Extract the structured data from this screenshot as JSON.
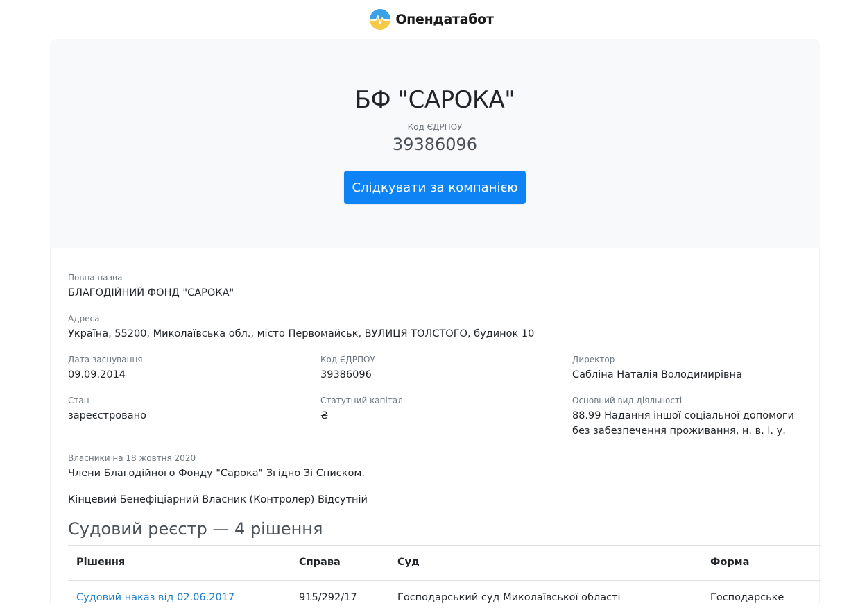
{
  "header": {
    "brand_name": "Опендатабот",
    "logo_icon": "opendatabot-logo-icon",
    "colors": {
      "logo_blue": "#3aa0e8",
      "logo_yellow": "#f7c948"
    }
  },
  "company": {
    "short_name": "БФ \"САРОКА\"",
    "code_label": "Код ЄДРПОУ",
    "code": "39386096",
    "follow_label": "Слідкувати за компанією",
    "accent_color": "#0d83f5"
  },
  "details": {
    "full_name_label": "Повна назва",
    "full_name": "БЛАГОДІЙНИЙ ФОНД \"САРОКА\"",
    "address_label": "Адреса",
    "address": "Україна, 55200, Миколаївська обл., місто Первомайськ, ВУЛИЦЯ ТОЛСТОГО, будинок 10",
    "founded_label": "Дата заснування",
    "founded": "09.09.2014",
    "edrpou_label": "Код ЄДРПОУ",
    "edrpou": "39386096",
    "director_label": "Директор",
    "director": "Сабліна Наталія Володимирівна",
    "status_label": "Стан",
    "status": "зареєстровано",
    "capital_label": "Статутний капітал",
    "capital": "₴",
    "activity_label": "Основний вид діяльності",
    "activity_line1": "88.99 Надання іншої соціальної допомоги",
    "activity_line2": "без забезпечення проживання, н. в. і. у.",
    "owners_label": "Власники на 18 жовтня 2020",
    "owners": "Члени Благодійного Фонду \"Сарока\" Згідно Зі Списком.",
    "beneficiary": "Кінцевий Бенефіціарний Власник (Контролер) Відсутній"
  },
  "court": {
    "title": "Судовий реєстр — 4 рішення",
    "columns": [
      "Рішення",
      "Справа",
      "Суд",
      "Форма"
    ],
    "rows": [
      {
        "decision": "Судовий наказ від 02.06.2017",
        "case": "915/292/17",
        "court": "Господарський суд Миколаївської області",
        "form": "Господарське"
      }
    ],
    "link_color": "#1e7fcb"
  }
}
